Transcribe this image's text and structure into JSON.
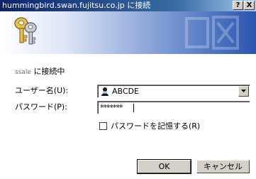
{
  "window": {
    "title": "hummingbird.swan.fujitsu.co.jp に接続",
    "help_button": "?",
    "close_button": "X"
  },
  "banner": {
    "icon": "keys-icon"
  },
  "form": {
    "connecting_host": "ssale",
    "connecting_suffix": "に接続中",
    "username_label": "ユーザー名(U):",
    "username_value": "ABCDE",
    "password_label": "パスワード(P):",
    "password_value": "*******",
    "remember_label": "パスワードを記憶する(R)",
    "remember_checked": false
  },
  "buttons": {
    "ok": "OK",
    "cancel": "キャンセル"
  }
}
